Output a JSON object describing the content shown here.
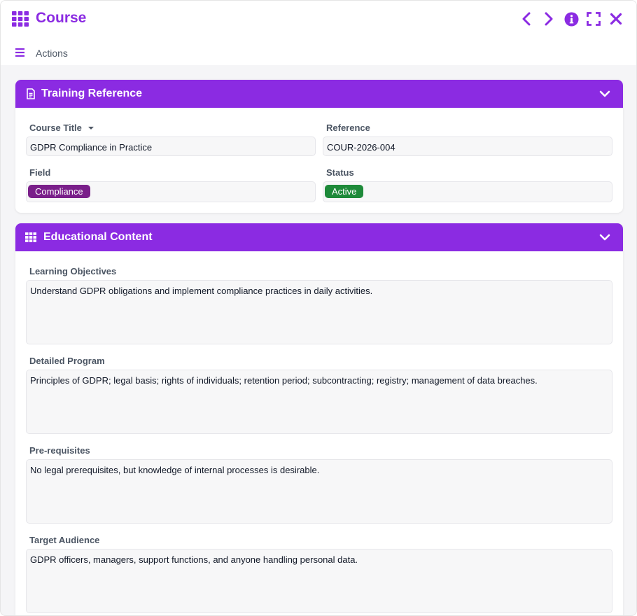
{
  "window": {
    "title": "Course",
    "icons": [
      "grid-icon",
      "chevron-left-icon",
      "chevron-right-icon",
      "info-icon",
      "fullscreen-icon",
      "close-icon"
    ]
  },
  "actions": {
    "label": "Actions",
    "icon": "menu-icon"
  },
  "colors": {
    "accent": "#8b2be2",
    "field_pill": "#7a1f8a",
    "status_pill": "#1e8a3a"
  },
  "training_reference": {
    "title": "Training Reference",
    "icon": "document-icon",
    "course_title_label": "Course Title",
    "course_title_value": "GDPR Compliance in Practice",
    "reference_label": "Reference",
    "reference_value": "COUR-2026-004",
    "field_label": "Field",
    "field_value": "Compliance",
    "status_label": "Status",
    "status_value": "Active"
  },
  "educational_content": {
    "title": "Educational Content",
    "icon": "table-icon",
    "learning_objectives_label": "Learning Objectives",
    "learning_objectives_value": "Understand GDPR obligations and implement compliance practices in daily activities.",
    "detailed_program_label": "Detailed Program",
    "detailed_program_value": "Principles of GDPR; legal basis; rights of individuals; retention period; subcontracting; registry; management of data breaches.",
    "prerequisites_label": "Pre-requisites",
    "prerequisites_value": "No legal prerequisites, but knowledge of internal processes is desirable.",
    "target_audience_label": "Target Audience",
    "target_audience_value": "GDPR officers, managers, support functions, and anyone handling personal data."
  }
}
